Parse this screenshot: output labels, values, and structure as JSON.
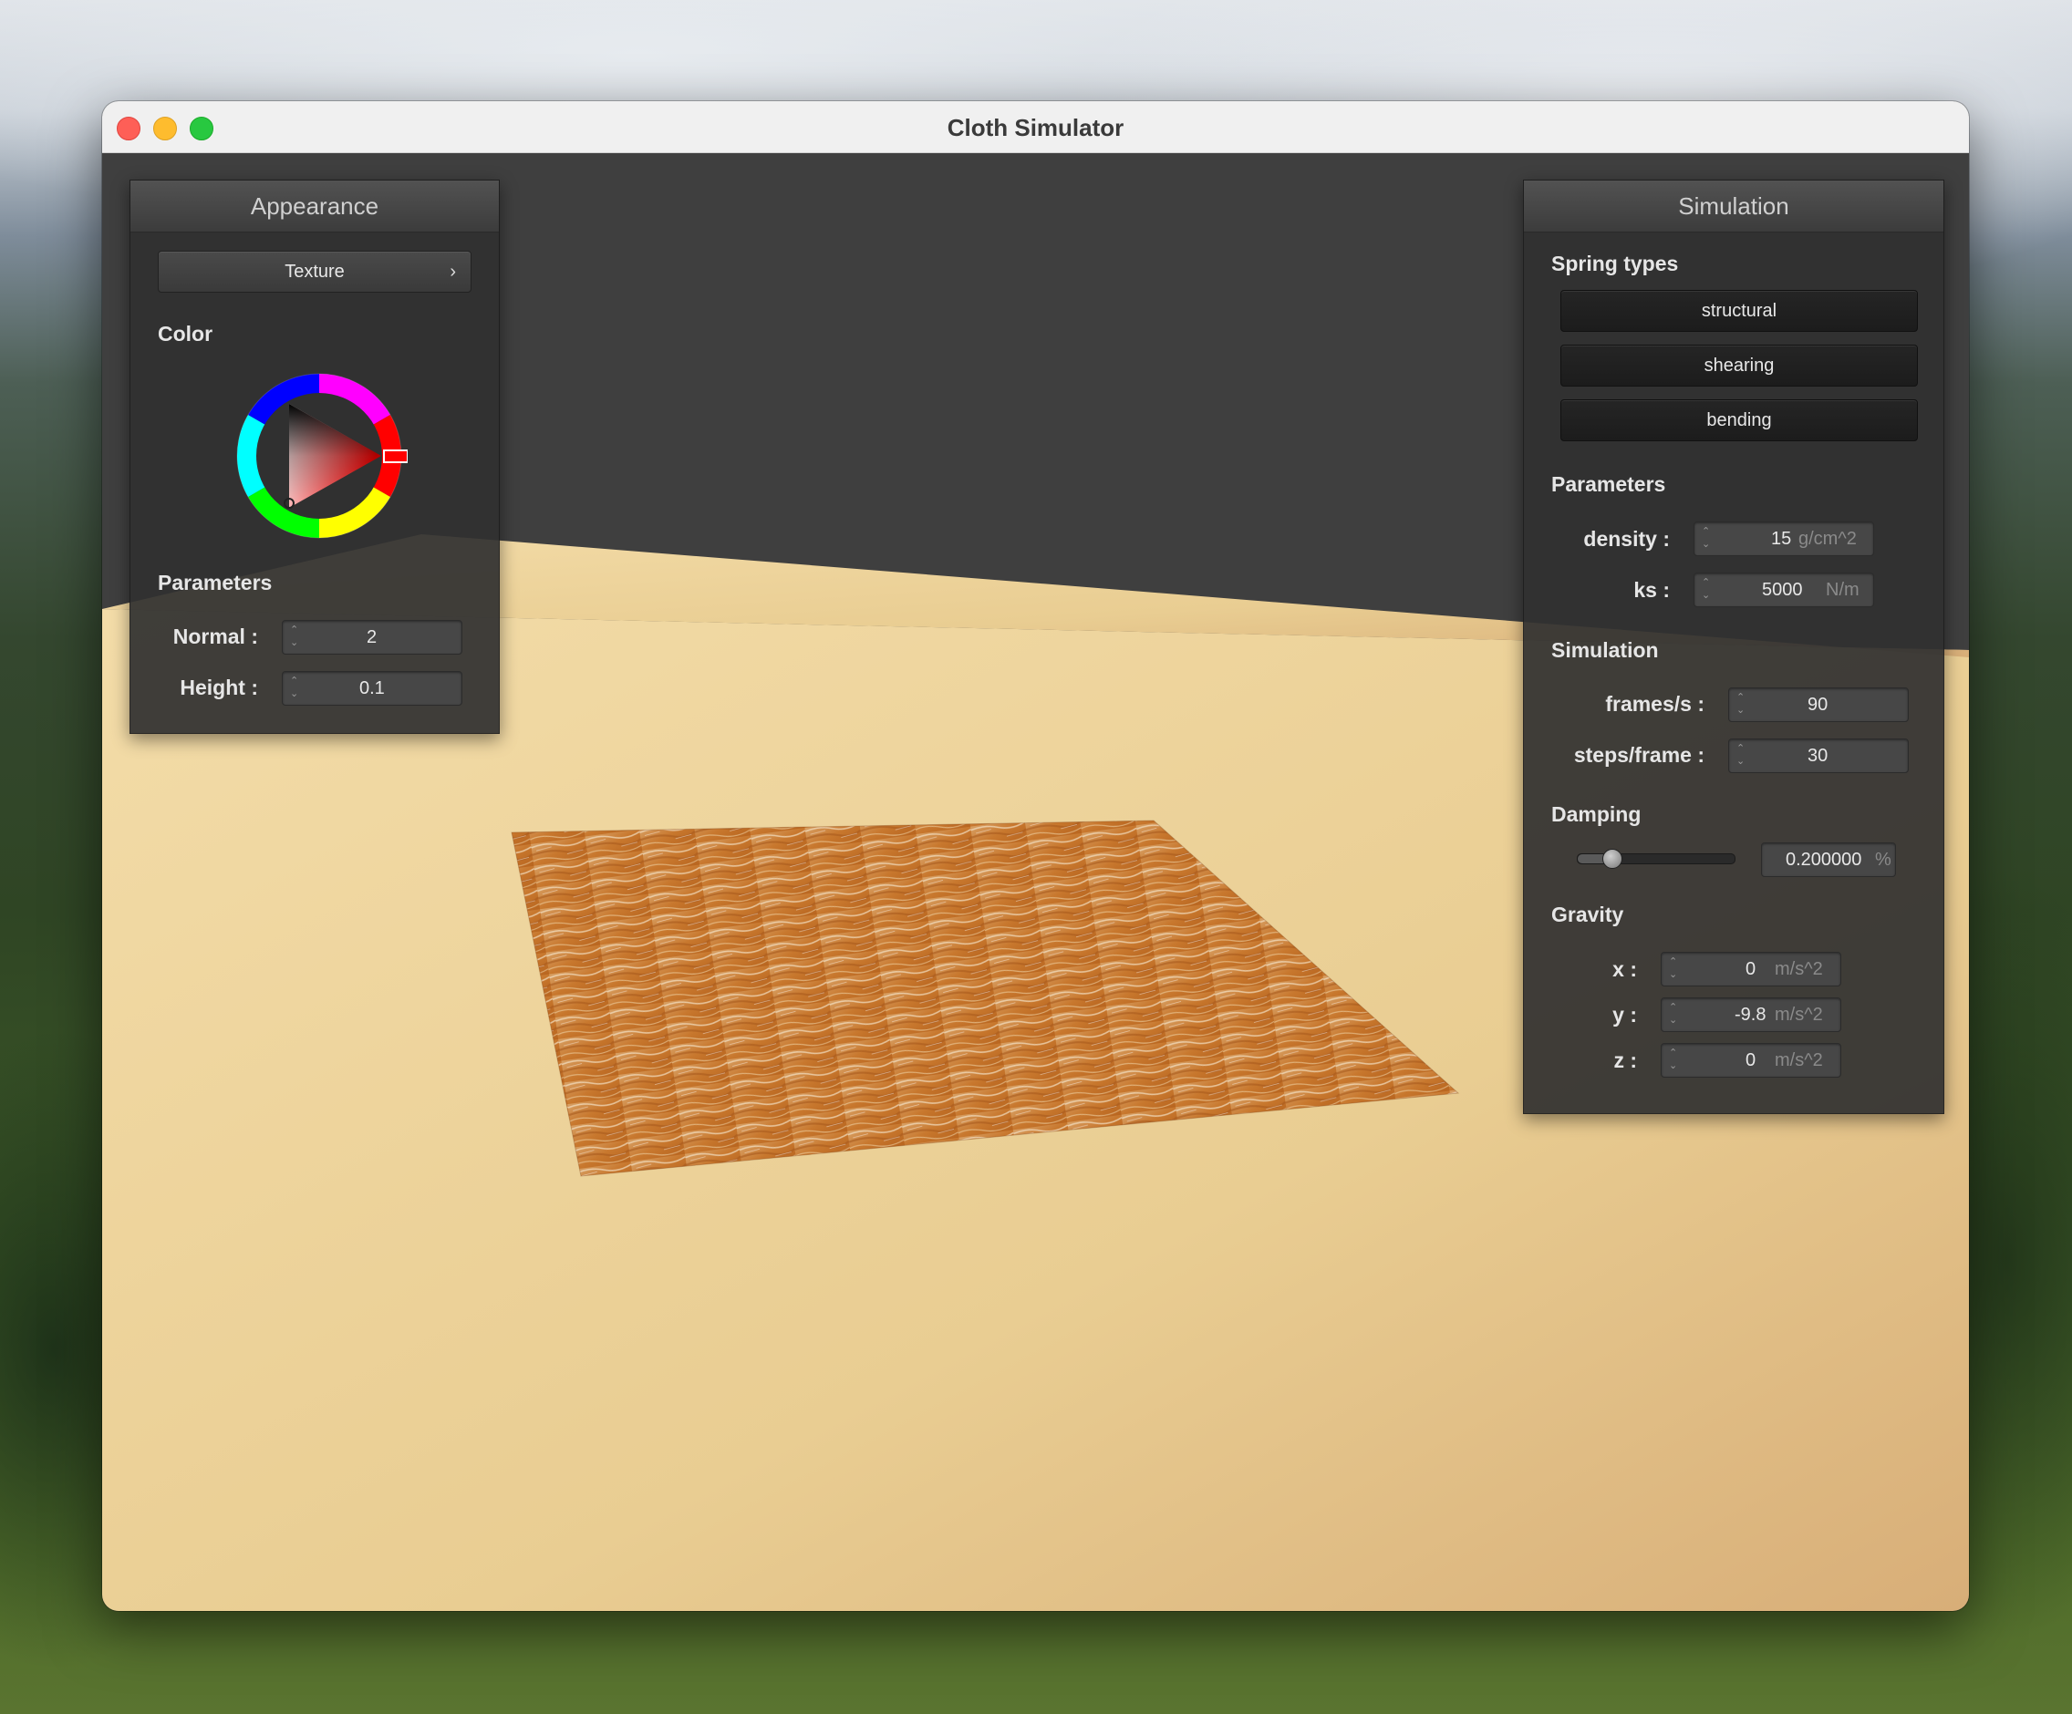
{
  "window": {
    "title": "Cloth Simulator"
  },
  "appearance": {
    "header": "Appearance",
    "texture_button": "Texture",
    "color_label": "Color",
    "parameters_label": "Parameters",
    "normal_label": "Normal :",
    "normal_value": "2",
    "height_label": "Height :",
    "height_value": "0.1",
    "selected_color": "#ff0000"
  },
  "simulation": {
    "header": "Simulation",
    "spring_types_label": "Spring types",
    "spring_buttons": [
      "structural",
      "shearing",
      "bending"
    ],
    "parameters_label": "Parameters",
    "density_label": "density :",
    "density_value": "15",
    "density_unit": "g/cm^2",
    "ks_label": "ks :",
    "ks_value": "5000",
    "ks_unit": "N/m",
    "simulation_label": "Simulation",
    "fps_label": "frames/s :",
    "fps_value": "90",
    "steps_label": "steps/frame :",
    "steps_value": "30",
    "damping_label": "Damping",
    "damping_value": "0.200000",
    "damping_unit": "%",
    "damping_slider_fraction": 0.2,
    "gravity_label": "Gravity",
    "gx_label": "x :",
    "gx_value": "0",
    "gy_label": "y :",
    "gy_value": "-9.8",
    "gz_label": "z :",
    "gz_value": "0",
    "gravity_unit": "m/s^2"
  },
  "colors": {
    "floor_light": "#f0d7a2",
    "floor_dark": "#d9b27a",
    "background_dark": "#3f3f3f",
    "cloth_base": "#c9782e"
  }
}
